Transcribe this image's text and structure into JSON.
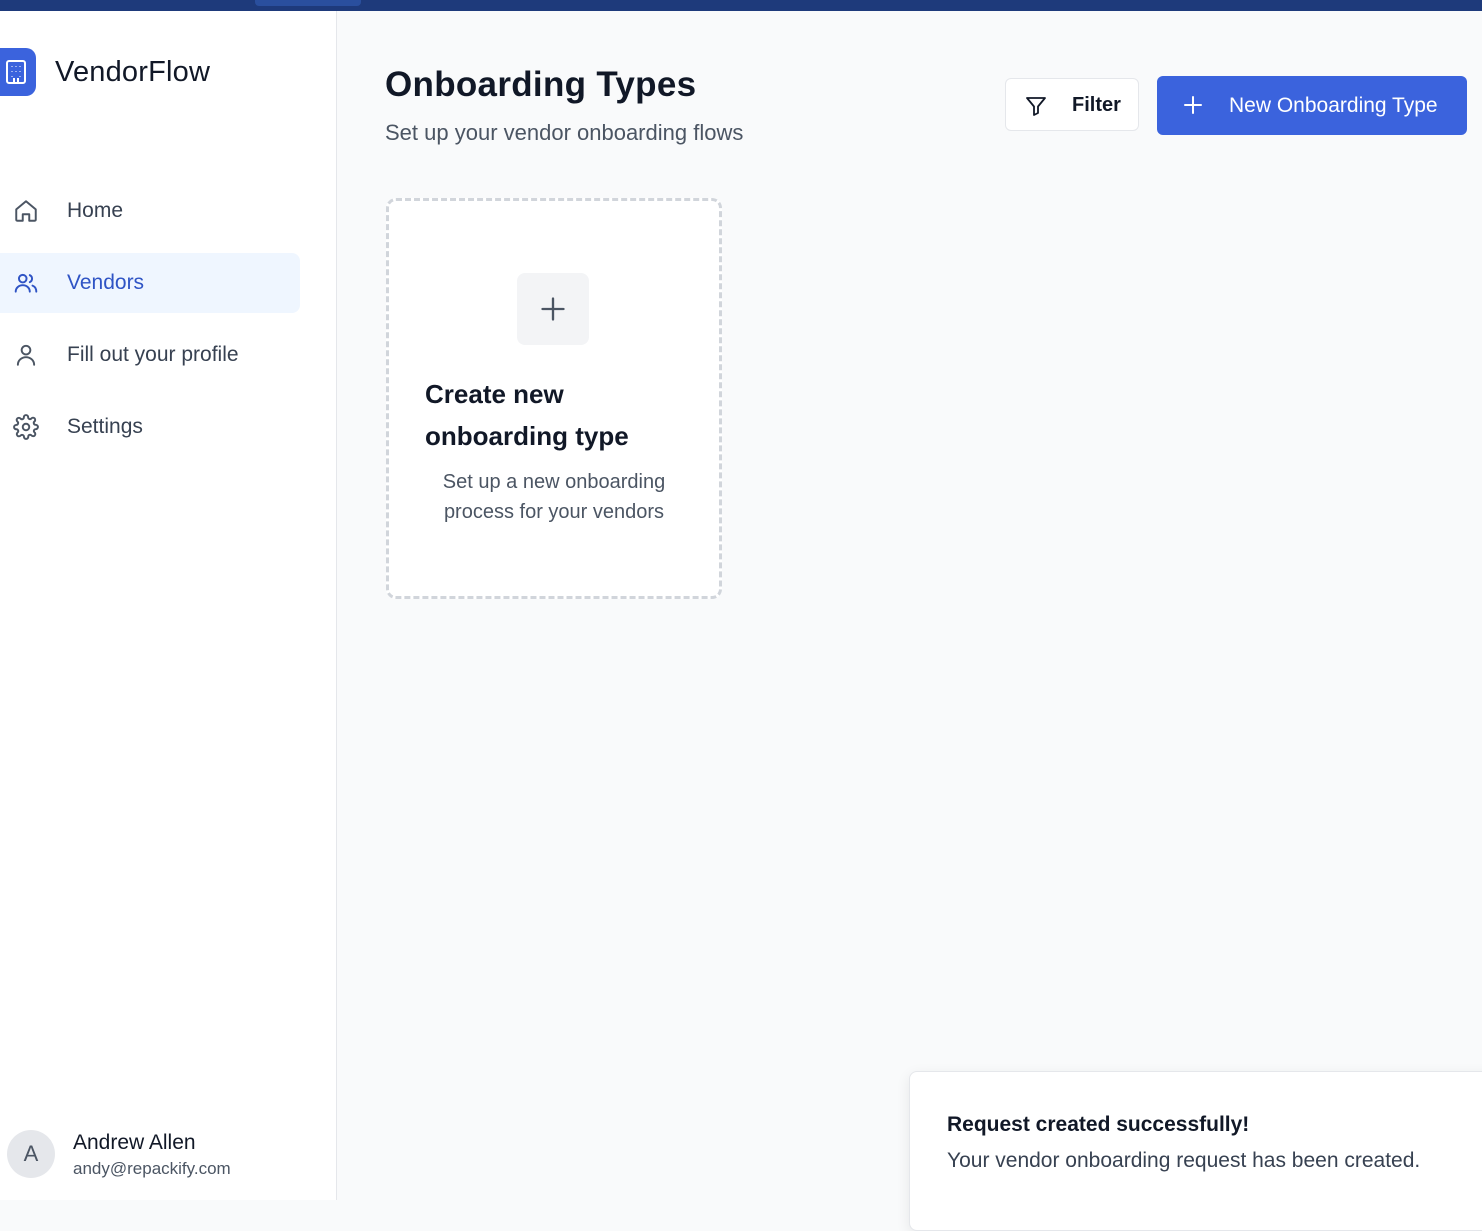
{
  "app": {
    "name": "VendorFlow",
    "accent_color": "#3b63dd",
    "logo_icon": "building-icon"
  },
  "sidebar": {
    "items": [
      {
        "label": "Home",
        "icon": "home-icon",
        "active": false
      },
      {
        "label": "Vendors",
        "icon": "users-icon",
        "active": true
      },
      {
        "label": "Fill out your profile",
        "icon": "user-icon",
        "active": false
      },
      {
        "label": "Settings",
        "icon": "gear-icon",
        "active": false
      }
    ],
    "user": {
      "initial": "A",
      "name": "Andrew Allen",
      "email": "andy@repackify.com"
    }
  },
  "header": {
    "title": "Onboarding Types",
    "subtitle": "Set up your vendor onboarding flows",
    "filter_label": "Filter",
    "new_button_label": "New Onboarding Type"
  },
  "create_card": {
    "title": "Create new onboarding type",
    "description": "Set up a new onboarding process for your vendors"
  },
  "toast": {
    "title": "Request created successfully!",
    "message": "Your vendor onboarding request has been created."
  }
}
